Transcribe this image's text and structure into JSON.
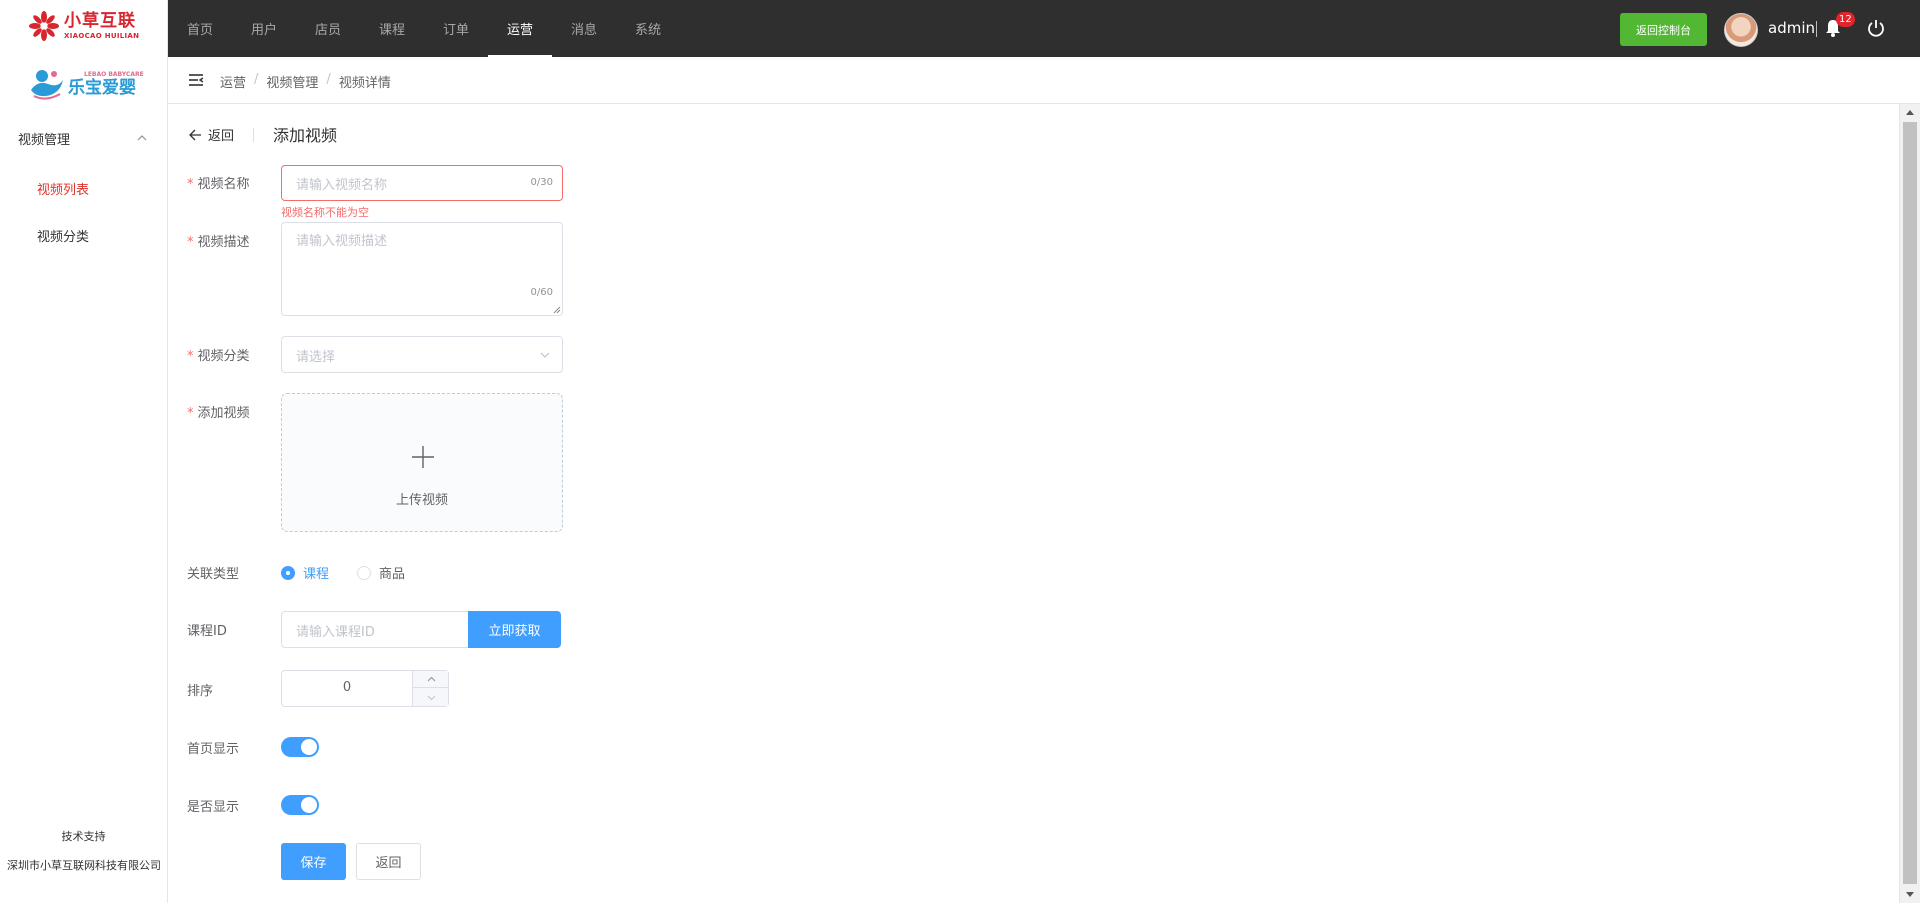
{
  "brand": {
    "logo1_cn": "小草互联",
    "logo1_en": "XIAOCAO HUILIAN",
    "logo2_en": "LEBAO BABYCARE",
    "logo2_cn": "乐宝爱婴"
  },
  "sidebar": {
    "group_label": "视频管理",
    "items": [
      {
        "label": "视频列表",
        "active": true
      },
      {
        "label": "视频分类",
        "active": false
      }
    ],
    "footer_title": "技术支持",
    "footer_company": "深圳市小草互联网科技有限公司"
  },
  "topnav": {
    "items": [
      {
        "label": "首页",
        "active": false
      },
      {
        "label": "用户",
        "active": false
      },
      {
        "label": "店员",
        "active": false
      },
      {
        "label": "课程",
        "active": false
      },
      {
        "label": "订单",
        "active": false
      },
      {
        "label": "运营",
        "active": true
      },
      {
        "label": "消息",
        "active": false
      },
      {
        "label": "系统",
        "active": false
      }
    ],
    "console_button": "返回控制台",
    "username": "admin",
    "notification_count": "12"
  },
  "breadcrumb": [
    "运营",
    "视频管理",
    "视频详情"
  ],
  "page": {
    "back_label": "返回",
    "title": "添加视频"
  },
  "form": {
    "name": {
      "label": "视频名称",
      "placeholder": "请输入视频名称",
      "count": "0/30",
      "error": "视频名称不能为空"
    },
    "desc": {
      "label": "视频描述",
      "placeholder": "请输入视频描述",
      "count": "0/60"
    },
    "category": {
      "label": "视频分类",
      "placeholder": "请选择"
    },
    "video": {
      "label": "添加视频",
      "upload_text": "上传视频"
    },
    "relation": {
      "label": "关联类型",
      "options": [
        {
          "label": "课程",
          "checked": true
        },
        {
          "label": "商品",
          "checked": false
        }
      ]
    },
    "course_id": {
      "label": "课程ID",
      "placeholder": "请输入课程ID",
      "button": "立即获取"
    },
    "sort": {
      "label": "排序",
      "value": "0"
    },
    "home_show": {
      "label": "首页显示",
      "on": true
    },
    "visible": {
      "label": "是否显示",
      "on": true
    },
    "save_button": "保存",
    "back_button": "返回"
  },
  "colors": {
    "primary": "#409eff",
    "danger": "#f56c6c",
    "success": "#52b833",
    "topbar": "#2f2f2f",
    "brand_red": "#d8262f"
  }
}
